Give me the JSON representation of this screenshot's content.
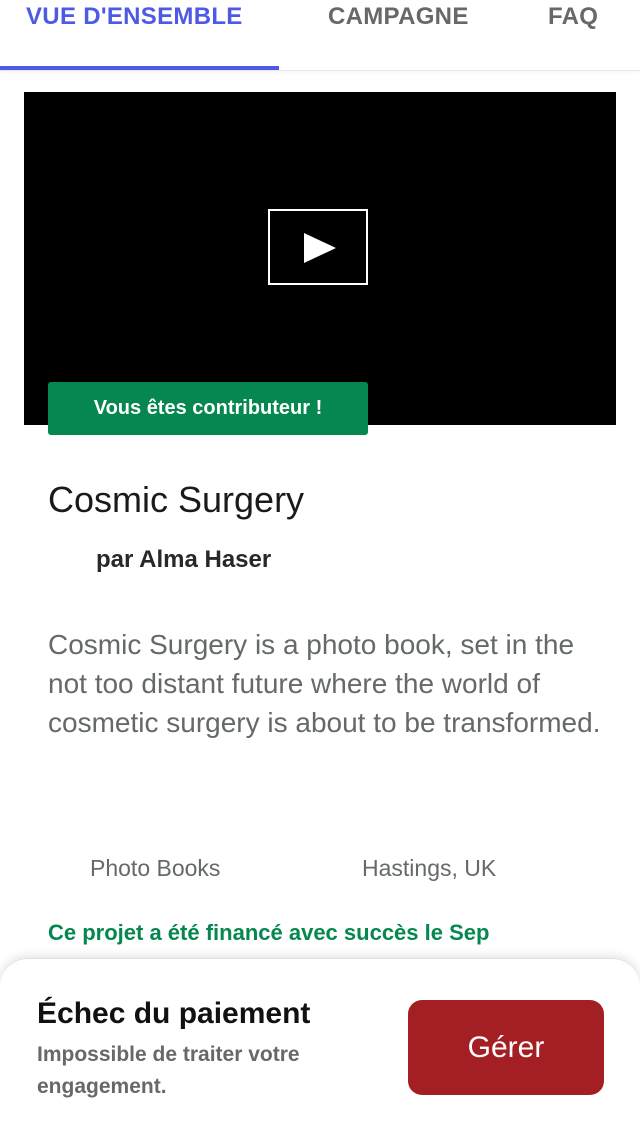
{
  "tabs": [
    {
      "label": "VUE D'ENSEMBLE",
      "active": true
    },
    {
      "label": "CAMPAGNE",
      "active": false
    },
    {
      "label": "FAQ",
      "active": false
    }
  ],
  "video": {
    "play_icon": "play-icon",
    "backer_badge": "Vous êtes contributeur !"
  },
  "project": {
    "title": "Cosmic Surgery",
    "creator": "par Alma Haser",
    "blurb": "Cosmic Surgery is a photo book, set in the not too distant future where the world of cosmetic surgery is about to be transformed.",
    "category": "Photo Books",
    "location": "Hastings, UK",
    "funded_note": "Ce projet a été financé avec succès le Sep"
  },
  "payment_alert": {
    "title": "Échec du paiement",
    "message": "Impossible de traiter votre engagement.",
    "button_label": "Gérer"
  },
  "colors": {
    "accent": "#4d5ae6",
    "success_green": "#05874f",
    "alert_red": "#a41f24",
    "muted_text": "#656969"
  }
}
